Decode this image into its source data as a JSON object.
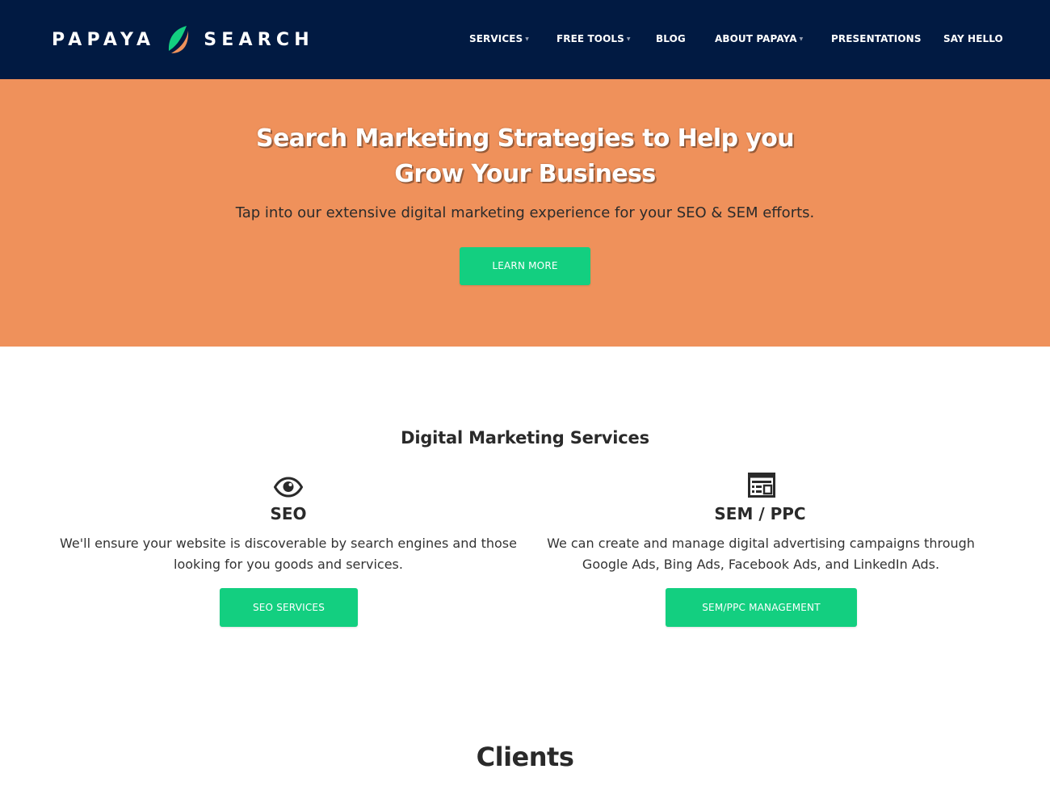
{
  "brand": {
    "word_left": "PAPAYA",
    "word_right": "SEARCH",
    "logo_icon": "papaya-leaf-icon",
    "colors": {
      "navy": "#011a42",
      "orange": "#ef915b",
      "green": "#13cf80",
      "leaf_green": "#13cf80",
      "leaf_orange": "#ef915b"
    }
  },
  "nav": {
    "items": [
      {
        "label": "SERVICES",
        "has_dropdown": true
      },
      {
        "label": "FREE TOOLS",
        "has_dropdown": true
      },
      {
        "label": "BLOG",
        "has_dropdown": false
      },
      {
        "label": "ABOUT PAPAYA",
        "has_dropdown": true
      },
      {
        "label": "PRESENTATIONS",
        "has_dropdown": false
      },
      {
        "label": "SAY HELLO",
        "has_dropdown": false
      }
    ],
    "dropdown_icon": "chevron-down-icon"
  },
  "hero": {
    "title_line1": "Search Marketing Strategies to Help you",
    "title_line2": "Grow Your Business",
    "subtitle": "Tap into our extensive digital marketing experience for your SEO & SEM efforts.",
    "button_label": "LEARN MORE"
  },
  "services": {
    "heading": "Digital Marketing Services",
    "items": [
      {
        "icon": "eye-icon",
        "title": "SEO",
        "description_line1": "We'll ensure your website is discoverable by search engines and those",
        "description_line2": "looking for you goods and services.",
        "button_label": "SEO SERVICES"
      },
      {
        "icon": "browser-layout-icon",
        "title": "SEM / PPC",
        "description_line1": "We can create and manage digital advertising campaigns through",
        "description_line2": "Google Ads, Bing Ads, Facebook Ads, and LinkedIn Ads.",
        "button_label": "SEM/PPC MANAGEMENT"
      }
    ]
  },
  "clients": {
    "heading": "Clients"
  }
}
